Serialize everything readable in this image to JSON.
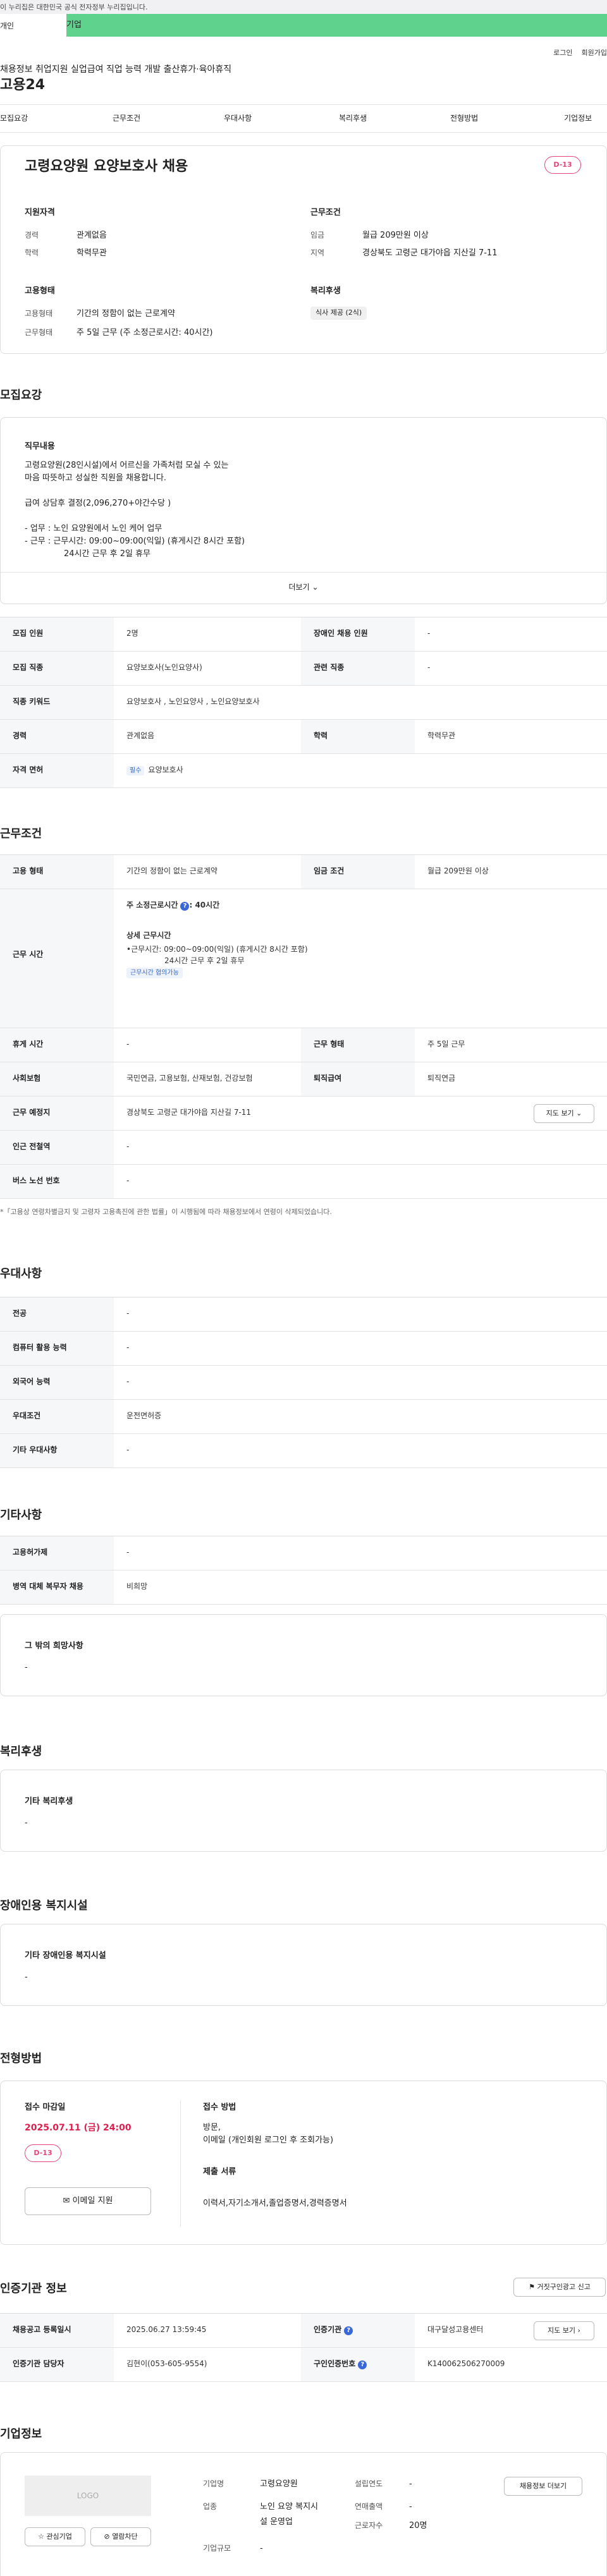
{
  "gov_notice": "이 누리집은 대한민국 공식 전자정부 누리집입니다.",
  "tabs": {
    "personal": "개인",
    "company": "기업"
  },
  "util": {
    "login": "로그인",
    "signup": "회원가입"
  },
  "logo": "고용24",
  "gnb": [
    "채용정보",
    "취업지원",
    "실업급여",
    "직업 능력 개발",
    "출산휴가·육아휴직"
  ],
  "snb": [
    "모집요강",
    "근무조건",
    "우대사항",
    "복리후생",
    "전형방법",
    "기업정보"
  ],
  "job": {
    "title": "고령요양원 요양보호사 채용",
    "dday": "D-13",
    "qual_title": "지원자격",
    "career_label": "경력",
    "career": "관계없음",
    "edu_label": "학력",
    "edu": "학력무관",
    "work_title": "근무조건",
    "wage_label": "임금",
    "wage": "월급 209만원 이상",
    "area_label": "지역",
    "area": "경상북도 고령군 대가야읍 지산길 7-11",
    "emp_title": "고용형태",
    "emp_type_label": "고용형태",
    "emp_type": "기간의 정함이 없는 근로계약",
    "work_form_label": "근무형태",
    "work_form": "주 5일 근무 (주 소정근로시간: 40시간)",
    "welfare_title": "복리후생",
    "welfare_tag": "식사 제공 (2식)"
  },
  "recruit": {
    "section": "모집요강",
    "duty_title": "직무내용",
    "duty_lines": [
      "고령요양원(28인시설)에서 어르신을 가족처럼 모실 수 있는",
      "마음 따뜻하고 성실한 직원을 채용합니다.",
      "급여 상담후 결정(2,096,270+야간수당 )",
      "- 업무 : 노인 요양원에서 노인 케어 업무",
      "- 근무 : 근무시간: 09:00~09:00(익일) (휴게시간 8시간 포함)",
      "24시간 근무 후 2일 휴무"
    ],
    "more": "더보기",
    "rows": [
      [
        "모집 인원",
        "2명",
        "장애인 채용 인원",
        "-"
      ],
      [
        "모집 직종",
        "요양보호사(노인요양사)",
        "관련 직종",
        "-"
      ],
      [
        "직종 키워드",
        "요양보호사 , 노인요양사 , 노인요양보호사"
      ],
      [
        "경력",
        "관계없음",
        "학력",
        "학력무관"
      ],
      [
        "자격 면허",
        "요양보호사"
      ]
    ],
    "req_tag": "필수"
  },
  "condition": {
    "section": "근무조건",
    "emp_type_label": "고용 형태",
    "emp_type": "기간의 정함이 없는 근로계약",
    "wage_label": "임금 조건",
    "wage": "월급 209만원 이상",
    "time_label": "근무 시간",
    "weekly": "주 소정근로시간",
    "weekly_val": ": 40시간",
    "detail_title": "상세 근무시간",
    "detail_1": "•근무시간: 09:00~09:00(익일) (휴게시간 8시간 포함)",
    "detail_2": "24시간 근무 후 2일 휴무",
    "chip": "근무시간 협의가능",
    "rest_label": "휴게 시간",
    "rest": "-",
    "form_label": "근무 형태",
    "form": "주 5일 근무",
    "ins_label": "사회보험",
    "ins": "국민연금, 고용보험, 산재보험, 건강보험",
    "sev_label": "퇴직급여",
    "sev": "퇴직연금",
    "place_label": "근무 예정지",
    "place": "경상북도 고령군 대가야읍 지산길 7-11",
    "map_btn": "지도 보기",
    "station_label": "인근 전철역",
    "station": "-",
    "bus_label": "버스 노선 번호",
    "bus": "-",
    "note": "*「고용상 연령차별금지 및 고령자 고용촉진에 관한 법률」이 시행됨에 따라 채용정보에서 연령이 삭제되었습니다."
  },
  "pref": {
    "section": "우대사항",
    "rows": [
      [
        "전공",
        "-"
      ],
      [
        "컴퓨터 활용 능력",
        "-"
      ],
      [
        "외국어 능력",
        "-"
      ],
      [
        "우대조건",
        "운전면허증"
      ],
      [
        "기타 우대사항",
        "-"
      ]
    ]
  },
  "etc": {
    "section": "기타사항",
    "rows": [
      [
        "고용허가제",
        "-"
      ],
      [
        "병역 대체 복무자 채용",
        "비희망"
      ]
    ],
    "wish_title": "그 밖의 희망사항",
    "wish": "-"
  },
  "welfare": {
    "section": "복리후생",
    "title": "기타 복리후생",
    "val": "-"
  },
  "disabled": {
    "section": "장애인용 복지시설",
    "title": "기타 장애인용 복지시설",
    "val": "-"
  },
  "selection": {
    "section": "전형방법",
    "deadline_label": "접수 마감일",
    "deadline": "2025.07.11 (금) 24:00",
    "dday": "D-13",
    "email_btn": "이메일 지원",
    "method_title": "접수 방법",
    "method_1": "방문,",
    "method_2": "이메일 (개인회원 로그인 후 조회가능)",
    "docs_title": "제출 서류",
    "docs": "이력서,자기소개서,졸업증명서,경력증명서"
  },
  "agency": {
    "section": "인증기관 정보",
    "report_btn": "거짓구인광고 신고",
    "reg_label": "채용공고 등록일시",
    "reg": "2025.06.27 13:59:45",
    "org_label": "인증기관",
    "org": "대구달성고용센터",
    "map_btn": "지도 보기",
    "mgr_label": "인증기관 담당자",
    "mgr": "김현이(053-605-9554)",
    "no_label": "구인인증번호",
    "no": "K140062506270009"
  },
  "company": {
    "section": "기업정보",
    "logo": "LOGO",
    "fav": "관심기업",
    "block": "열람차단",
    "name_label": "기업명",
    "name": "고령요양원",
    "year_label": "설립연도",
    "year": "-",
    "biz_label": "업종",
    "biz_1": "노인 요양 복지시",
    "biz_2": "설 운영업",
    "sales_label": "연매출액",
    "sales": "-",
    "emp_label": "근로자수",
    "emp": "20명",
    "size_label": "기업규모",
    "size": "-",
    "info_btn": "채용정보 더보기"
  }
}
